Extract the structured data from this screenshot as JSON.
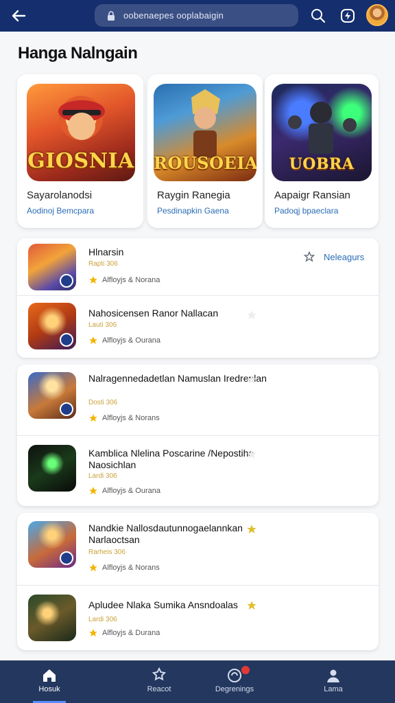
{
  "topbar": {
    "url": "oobenaepes ooplabaigin"
  },
  "page_title": "Hanga Nalngain",
  "featured": [
    {
      "logo": "GIOSNIA",
      "name": "Sayarolanodsi",
      "developer": "Aodinoj Bemcpara"
    },
    {
      "logo": "ROUSOEIA",
      "name": "Raygin Ranegia",
      "developer": "Pesdinapkin Gaena"
    },
    {
      "logo": "UOBRA",
      "name": "Aapaigr Ransian",
      "developer": "Padoqj bpaeclara"
    }
  ],
  "list_groups": [
    [
      {
        "title": "Hlnarsin",
        "price": "Rapti 306",
        "meta": "Alfloyjs  &  Norana",
        "link": "Neleagurs"
      },
      {
        "title": "Nahosicensen Ranor Nallacan",
        "price": "Lauti 306",
        "meta": "Alfloyjs  &  Ourana"
      }
    ],
    [
      {
        "title": "Nalragennedadetlan Namuslan Iredrenlan",
        "price": "Dosti 306",
        "meta": "Alfloyjs  &  Norans"
      },
      {
        "title": "Kamblica Nlelina Poscarine /Nepostiha Naosichlan",
        "price": "Lardi 306",
        "meta": "Alfloyjs  &  Ourana"
      }
    ],
    [
      {
        "title": "Nandkie Nallosdautunnogaelannkan Narlaoctsan",
        "price": "Rarheis 306",
        "meta": "Alfloyjs  &  Norans"
      },
      {
        "title": "Apludee Nlaka Sumika Ansndoalas",
        "price": "Lardi 306",
        "meta": "Alfloyjs  &  Durana"
      }
    ]
  ],
  "nav": [
    {
      "label": "Hosuk",
      "icon": "home-icon"
    },
    {
      "label": "Reacot",
      "icon": "puzzle-icon"
    },
    {
      "label": "Degrenings",
      "icon": "notification-icon"
    },
    {
      "label": "Lama",
      "icon": "profile-icon"
    }
  ],
  "colors": {
    "topbar": "#152f6e",
    "bottomnav": "#23375f",
    "link": "#2a6cb6",
    "star": "#f4b400"
  }
}
